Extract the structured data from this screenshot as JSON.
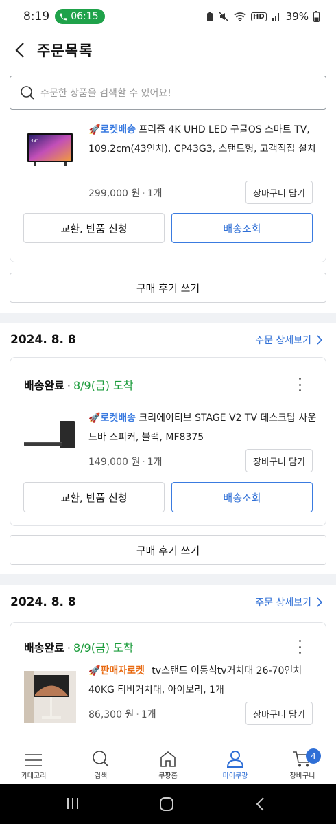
{
  "status_bar": {
    "time": "8:19",
    "call_time": "06:15",
    "battery": "39%",
    "hd_label": "HD"
  },
  "header": {
    "title": "주문목록"
  },
  "search": {
    "placeholder": "주문한 상품을 검색할 수 있어요!"
  },
  "orders_partial": {
    "item": {
      "badge": "로켓배송",
      "name": "프리즘 4K UHD LED 구글OS 스마트 TV, 109.2cm(43인치), CP43G3, 스탠드형, 고객직접 설치",
      "price": "299,000 원",
      "qty": "1개",
      "cart_label": "장바구니 담기"
    },
    "exchange_label": "교환, 반품 신청",
    "track_label": "배송조회",
    "review_label": "구매 후기 쓰기"
  },
  "orders": [
    {
      "date": "2024. 8. 8",
      "detail_label": "주문 상세보기",
      "status": "배송완료",
      "arrival": "8/9(금) 도착",
      "item": {
        "badge": "로켓배송",
        "name": "크리에이티브 STAGE V2 TV 데스크탑 사운드바 스피커, 블랙, MF8375",
        "price": "149,000 원",
        "qty": "1개",
        "cart_label": "장바구니 담기"
      },
      "exchange_label": "교환, 반품 신청",
      "track_label": "배송조회",
      "review_label": "구매 후기 쓰기"
    },
    {
      "date": "2024. 8. 8",
      "detail_label": "주문 상세보기",
      "status": "배송완료",
      "arrival": "8/9(금) 도착",
      "item": {
        "badge": "판매자로켓",
        "name": "tv스탠드 이동식tv거치대 26-70인치 40KG 티비거치대, 아이보리, 1개",
        "price": "86,300 원",
        "qty": "1개",
        "cart_label": "장바구니 담기"
      }
    }
  ],
  "bottom_nav": [
    {
      "label": "카테고리",
      "icon": "menu-icon"
    },
    {
      "label": "검색",
      "icon": "search-icon"
    },
    {
      "label": "쿠팡홈",
      "icon": "home-icon"
    },
    {
      "label": "마이쿠팡",
      "icon": "user-icon",
      "active": true
    },
    {
      "label": "장바구니",
      "icon": "cart-icon",
      "badge": "4"
    }
  ],
  "colors": {
    "accent": "#2f6fd6",
    "rocket": "#3a7be0",
    "seller_rocket": "#e86a12",
    "arrival": "#1c9c3c",
    "call": "#1fa24a"
  }
}
